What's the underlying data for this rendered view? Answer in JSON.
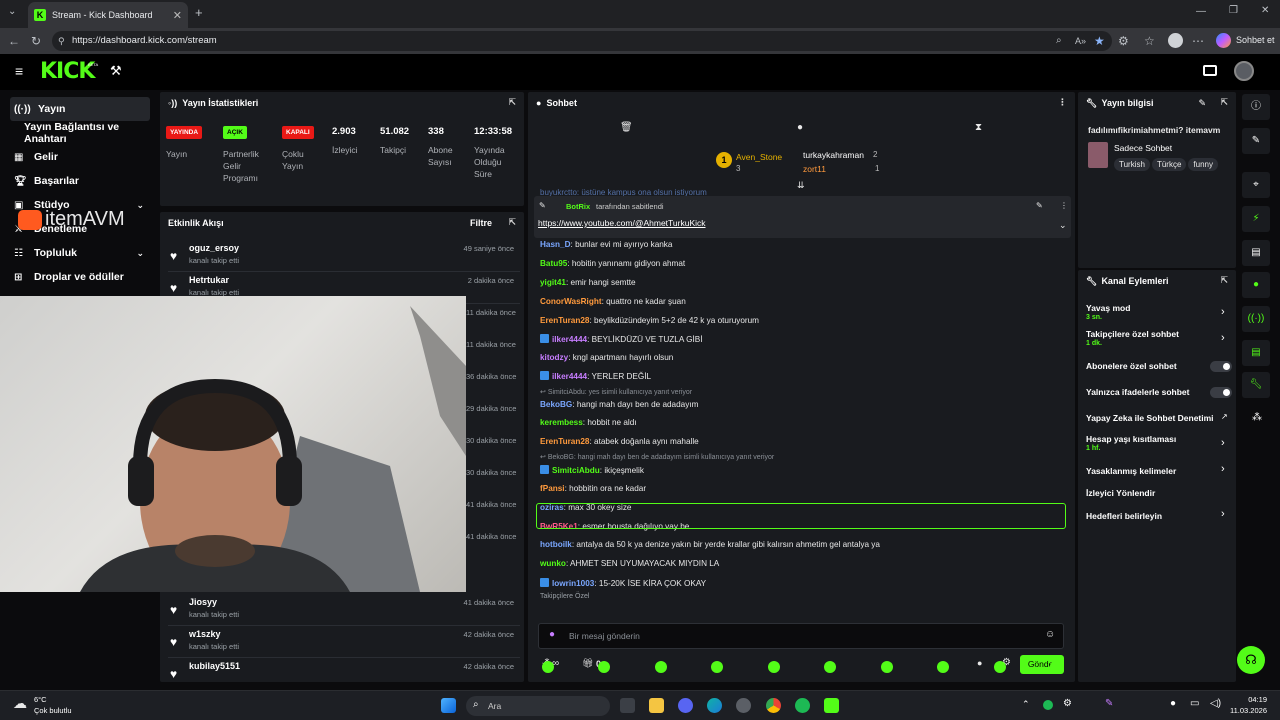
{
  "browser": {
    "tab_title": "Stream - Kick Dashboard",
    "url": "https://dashboard.kick.com/stream",
    "copilot_label": "Sohbet et"
  },
  "brand": {
    "logo": "KICK",
    "beta": "BETA",
    "accent": "#53fc18"
  },
  "sidebar": {
    "items": [
      {
        "label": "Yayın",
        "icon": "broadcast-icon",
        "active": true
      },
      {
        "label": "Yayın Bağlantısı ve Anahtarı"
      },
      {
        "label": "Gelir",
        "icon": "revenue-icon"
      },
      {
        "label": "Başarılar",
        "icon": "trophy-icon"
      },
      {
        "label": "Stüdyo",
        "icon": "studio-icon"
      },
      {
        "label": "Denetleme",
        "icon": "moderation-icon"
      },
      {
        "label": "Topluluk",
        "icon": "community-icon"
      },
      {
        "label": "Droplar ve ödüller",
        "icon": "gift-icon"
      }
    ]
  },
  "watermark": {
    "text": "itemAVM"
  },
  "stats": {
    "title": "Yayın İstatistikleri",
    "badges": [
      {
        "text": "YAYINDA",
        "label": "Yayın",
        "color": "#e91916"
      },
      {
        "text": "AÇIK",
        "label": "Partnerlik Gelir Programı",
        "color": "#53fc18"
      },
      {
        "text": "KAPALI",
        "label": "Çoklu Yayın",
        "color": "#e91916"
      }
    ],
    "metrics": [
      {
        "value": "2.903",
        "label": "İzleyici"
      },
      {
        "value": "51.082",
        "label": "Takipçi"
      },
      {
        "value": "338",
        "label": "Abone Sayısı"
      },
      {
        "value": "12:33:58",
        "label": "Yayında Olduğu Süre"
      }
    ]
  },
  "activity": {
    "title": "Etkinlik Akışı",
    "filter": "Filtre",
    "rows_top": [
      {
        "name": "oguz_ersoy",
        "sub": "kanalı takip etti",
        "time": "49 saniye önce"
      },
      {
        "name": "Hetrtukar",
        "sub": "kanalı takip etti",
        "time": "2 dakika önce"
      }
    ],
    "hidden_times": [
      "11 dakika önce",
      "11 dakika önce",
      "36 dakika önce",
      "29 dakika önce",
      "30 dakika önce",
      "30 dakika önce",
      "41 dakika önce",
      "41 dakika önce"
    ],
    "rows_bottom": [
      {
        "name": "Jiosyy",
        "sub": "kanalı takip etti",
        "time": "41 dakika önce"
      },
      {
        "name": "w1szky",
        "sub": "kanalı takip etti",
        "time": "42 dakika önce"
      },
      {
        "name": "kubilay5151",
        "sub": "",
        "time": "42 dakika önce"
      }
    ]
  },
  "chat": {
    "title": "Sohbet",
    "leaderboard": [
      {
        "rank": "1",
        "name": "Aven_Stone",
        "count": "3"
      },
      {
        "name": "turkaykahraman",
        "count": "2"
      },
      {
        "name": "zort11",
        "count": "1"
      }
    ],
    "partial_top": "buyukrctto: üstüne kampus ona olsun istiyorum",
    "pinned": {
      "by_user": "BotRix",
      "by_suffix": "tarafından sabitlendi",
      "link": "https://www.youtube.com/@AhmetTurkuKick"
    },
    "messages": [
      {
        "user": "Hasn_D",
        "text": "bunlar evi mi ayırıyo kanka",
        "color": "#7aa7ff"
      },
      {
        "user": "Batu95",
        "text": "hobitin yanınamı gidiyon ahmat",
        "color": "#53fc18"
      },
      {
        "user": "yigit41",
        "text": "emir hangi semtte",
        "color": "#53fc18"
      },
      {
        "user": "ConorWasRight",
        "text": "quattro ne kadar şuan",
        "color": "#ff9a3d"
      },
      {
        "user": "ErenTuran28",
        "text": "beylikdüzündeyim 5+2 de 42 k ya oturuyorum",
        "color": "#ff9a3d"
      },
      {
        "user": "ilker4444",
        "text": "BEYLİKDÜZÜ VE TUZLA GİBİ",
        "color": "#c77dff",
        "badges": true
      },
      {
        "user": "kitodzy",
        "text": "kngl apartmanı hayırlı olsun",
        "color": "#c77dff"
      },
      {
        "user": "ilker4444",
        "text": "YERLER DEĞİL",
        "color": "#c77dff",
        "badges": true
      },
      {
        "reply": "SimitciAbdu: yes isimli kullanıcıya yanıt veriyor"
      },
      {
        "user": "BekoBG",
        "text": "hangi mah dayı ben de adadayım",
        "color": "#7aa7ff"
      },
      {
        "user": "kerembess",
        "text": "hobbit ne aldı",
        "color": "#53fc18"
      },
      {
        "user": "ErenTuran28",
        "text": "atabek doğanla aynı mahalle",
        "color": "#ff9a3d"
      },
      {
        "reply": "BekoBG: hangi mah dayı ben de adadayım isimli kullanıcıya yanıt veriyor",
        "highlight": true
      },
      {
        "user": "SimitciAbdu",
        "text": "ikiçeşmelik",
        "color": "#53fc18",
        "badges": true,
        "highlight": true
      },
      {
        "user": "fPansi",
        "text": "hobbitin ora ne kadar",
        "color": "#ff9a3d"
      },
      {
        "user": "oziras",
        "text": "max 30 okey size",
        "color": "#7aa7ff"
      },
      {
        "user": "BwR5Ke1",
        "text": "esmer housta dağılıyo vay be",
        "color": "#ff5e8a"
      },
      {
        "user": "hotboilk",
        "text": "antalya da 50 k ya denize yakın bir yerde krallar gibi kalırsın ahmetim gel antalya ya",
        "color": "#7aa7ff"
      },
      {
        "user": "wunko",
        "text": "AHMET SEN UYUMAYACAK MIYDIN LA",
        "color": "#53fc18"
      },
      {
        "user": "lowrin1003",
        "text": "15-20K İSE KİRA ÇOK OKAY",
        "color": "#7aa7ff",
        "badges": true
      }
    ],
    "follower_only": "Takipçilere Özel",
    "input_placeholder": "Bir mesaj gönderin",
    "points": "0",
    "send_label": "Gönder"
  },
  "stream_info": {
    "title_label": "Yayın bilgisi",
    "stream_title": "fadılımıfikrimiahmetmi? itemavm",
    "category": "Sadece Sohbet",
    "tags": [
      "Turkish",
      "Türkçe",
      "funny"
    ]
  },
  "channel_actions": {
    "title": "Kanal Eylemleri",
    "items": [
      {
        "label": "Yavaş mod",
        "sub": "3 sn.",
        "control": "chevron"
      },
      {
        "label": "Takipçilere özel sohbet",
        "sub": "1 dk.",
        "control": "chevron"
      },
      {
        "label": "Abonelere özel sohbet",
        "control": "toggle"
      },
      {
        "label": "Yalnızca ifadelerle sohbet",
        "control": "toggle"
      },
      {
        "label": "Yapay Zeka ile Sohbet Denetimi",
        "control": "external"
      },
      {
        "label": "Hesap yaşı kısıtlaması",
        "sub": "1 hf.",
        "control": "chevron"
      },
      {
        "label": "Yasaklanmış kelimeler",
        "control": "chevron"
      },
      {
        "label": "İzleyici Yönlendir",
        "control": "none"
      },
      {
        "label": "Hedefleri belirleyin",
        "control": "chevron"
      }
    ]
  },
  "taskbar": {
    "weather_temp": "6°C",
    "weather_desc": "Çok bulutlu",
    "search": "Ara",
    "time": "04:19",
    "date": "11.03.2026"
  }
}
